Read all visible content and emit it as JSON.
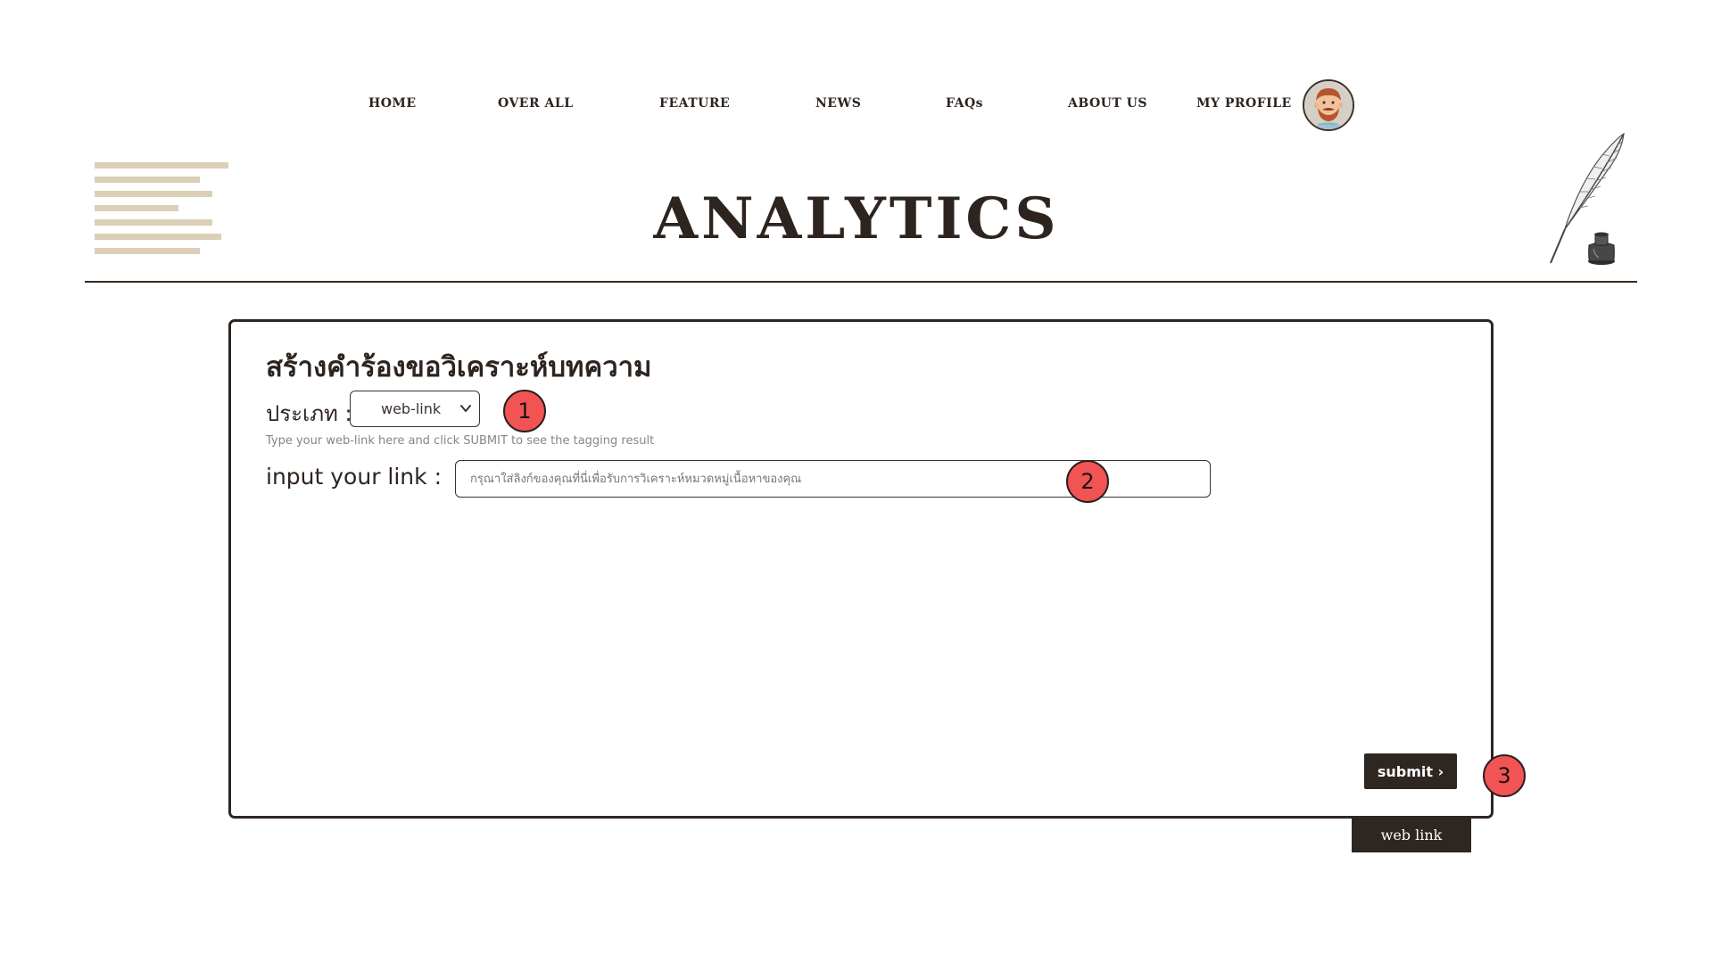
{
  "nav": {
    "items": [
      {
        "label": "HOME"
      },
      {
        "label": "OVER ALL"
      },
      {
        "label": "FEATURE"
      },
      {
        "label": "NEWS"
      },
      {
        "label": "FAQs"
      },
      {
        "label": "ABOUT US"
      },
      {
        "label": "MY PROFILE"
      }
    ],
    "avatar_icon": "bearded-man-avatar-icon"
  },
  "header": {
    "title": "ANALYTICS",
    "menu_icon": "menu-lines-icon",
    "decoration_icon": "quill-and-inkwell-icon"
  },
  "form": {
    "heading": "สร้างคำร้องขอวิเคราะห์บทความ",
    "type_label": "ประเภท :",
    "type_select": {
      "selected": "web-link"
    },
    "helper_text": "Type your web-link here and click SUBMIT to see the tagging result",
    "link_label": "input your link :",
    "link_input": {
      "value": "",
      "placeholder": "กรุณาใส่ลิงก์ของคุณที่นี่เพื่อรับการวิเคราะห์หมวดหมู่เนื้อหาของคุณ"
    },
    "submit_label": "submit ›",
    "tab_label": "web link"
  },
  "markers": [
    "1",
    "2",
    "3"
  ],
  "colors": {
    "primary_dark": "#2e2621",
    "accent_beige": "#dbcfb7",
    "marker_red": "#f25454",
    "helper_gray": "#8a8580"
  }
}
